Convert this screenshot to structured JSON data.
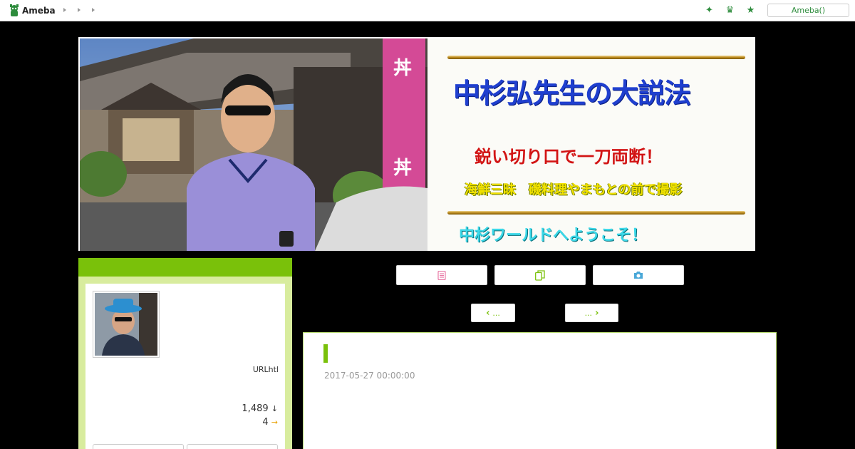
{
  "header": {
    "logo_text": "Ameba",
    "nav_icons": [
      "chevron-right-icon",
      "chevron-right-icon",
      "chevron-right-icon"
    ],
    "right_icons": [
      "sparkle-icon",
      "crown-icon",
      "star-icon"
    ],
    "button_label": "Ameba()",
    "accent_color": "#2d8c3c"
  },
  "banner": {
    "title": "中杉弘先生の大説法",
    "subtitle1": "鋭い切り口で一刀両断！",
    "subtitle2": "海鮮三昧　磯料理やまもとの前で撮影",
    "subtitle3": "中杉ワールドへようこそ！"
  },
  "sidebar": {
    "profile_url_text": "URLhtl",
    "followers": "1,489",
    "followers_icon": "↓",
    "ranking": "4",
    "ranking_icon": "→",
    "accent_color": "#7ac10a"
  },
  "main": {
    "tabs": [
      {
        "icon": "document-icon",
        "color": "#e87aa6"
      },
      {
        "icon": "copy-icon",
        "color": "#7ac10a"
      },
      {
        "icon": "camera-icon",
        "color": "#4aa8d8"
      }
    ],
    "pager": {
      "prev_label": "...",
      "next_label": "..."
    },
    "article": {
      "title": "",
      "date": "2017-05-27 00:00:00"
    }
  }
}
